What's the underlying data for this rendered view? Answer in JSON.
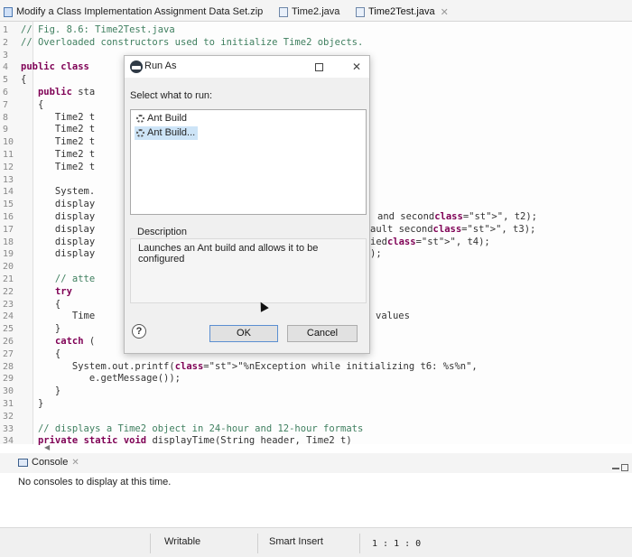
{
  "tabs": [
    {
      "label": "Modify a Class Implementation Assignment Data Set.zip",
      "icon": "project-icon",
      "closable": false
    },
    {
      "label": "Time2.java",
      "icon": "java-file-icon",
      "closable": false
    },
    {
      "label": "Time2Test.java",
      "icon": "java-file-icon",
      "closable": true
    }
  ],
  "editor": {
    "lines": [
      {
        "n": "1",
        "text": "// Fig. 8.6: Time2Test.java"
      },
      {
        "n": "2",
        "text": "// Overloaded constructors used to initialize Time2 objects."
      },
      {
        "n": "3",
        "text": ""
      },
      {
        "n": "4",
        "text": "public class"
      },
      {
        "n": "5",
        "text": "{"
      },
      {
        "n": "6",
        "text": "   public sta"
      },
      {
        "n": "7",
        "text": "   {"
      },
      {
        "n": "8",
        "text": "      Time2 t"
      },
      {
        "n": "9",
        "text": "      Time2 t"
      },
      {
        "n": "10",
        "text": "      Time2 t"
      },
      {
        "n": "11",
        "text": "      Time2 t"
      },
      {
        "n": "12",
        "text": "      Time2 t"
      },
      {
        "n": "13",
        "text": ""
      },
      {
        "n": "14",
        "text": "      System."
      },
      {
        "n": "15",
        "text": "      display"
      },
      {
        "n": "16",
        "text": "      display"
      },
      {
        "n": "17",
        "text": "      display"
      },
      {
        "n": "18",
        "text": "      display"
      },
      {
        "n": "19",
        "text": "      display"
      },
      {
        "n": "20",
        "text": ""
      },
      {
        "n": "21",
        "text": "      // atte"
      },
      {
        "n": "22",
        "text": "      try"
      },
      {
        "n": "23",
        "text": "      {"
      },
      {
        "n": "24",
        "text": "         Time"
      },
      {
        "n": "25",
        "text": "      }"
      },
      {
        "n": "26",
        "text": "      catch ("
      },
      {
        "n": "27",
        "text": "      {"
      },
      {
        "n": "28",
        "text": "         System.out.printf(\"%nException while initializing t6: %s%n\","
      },
      {
        "n": "29",
        "text": "            e.getMessage());"
      },
      {
        "n": "30",
        "text": "      }"
      },
      {
        "n": "31",
        "text": "   }"
      },
      {
        "n": "32",
        "text": ""
      },
      {
        "n": "33",
        "text": "   // displays a Time2 object in 24-hour and 12-hour formats"
      },
      {
        "n": "34",
        "text": "   private static void displayTime(String header, Time2 t)"
      }
    ],
    "overflow_right": [
      {
        "line": "16",
        "text": "and second\", t2);"
      },
      {
        "line": "17",
        "text": "ault second\", t3);"
      },
      {
        "line": "18",
        "text": "ied\", t4);"
      },
      {
        "line": "19",
        "text": ");"
      },
      {
        "line": "24",
        "text": "values"
      }
    ]
  },
  "dialog": {
    "title": "Run As",
    "prompt": "Select what to run:",
    "options": [
      {
        "label": "Ant Build",
        "selected": false
      },
      {
        "label": "Ant Build...",
        "selected": true
      }
    ],
    "description_label": "Description",
    "description_text": "Launches an Ant build and allows it to be configured",
    "ok_label": "OK",
    "cancel_label": "Cancel",
    "help_label": "?"
  },
  "console": {
    "tab_label": "Console",
    "message": "No consoles to display at this time."
  },
  "statusbar": {
    "writable": "Writable",
    "insert_mode": "Smart Insert",
    "position": "1 : 1 : 0"
  }
}
